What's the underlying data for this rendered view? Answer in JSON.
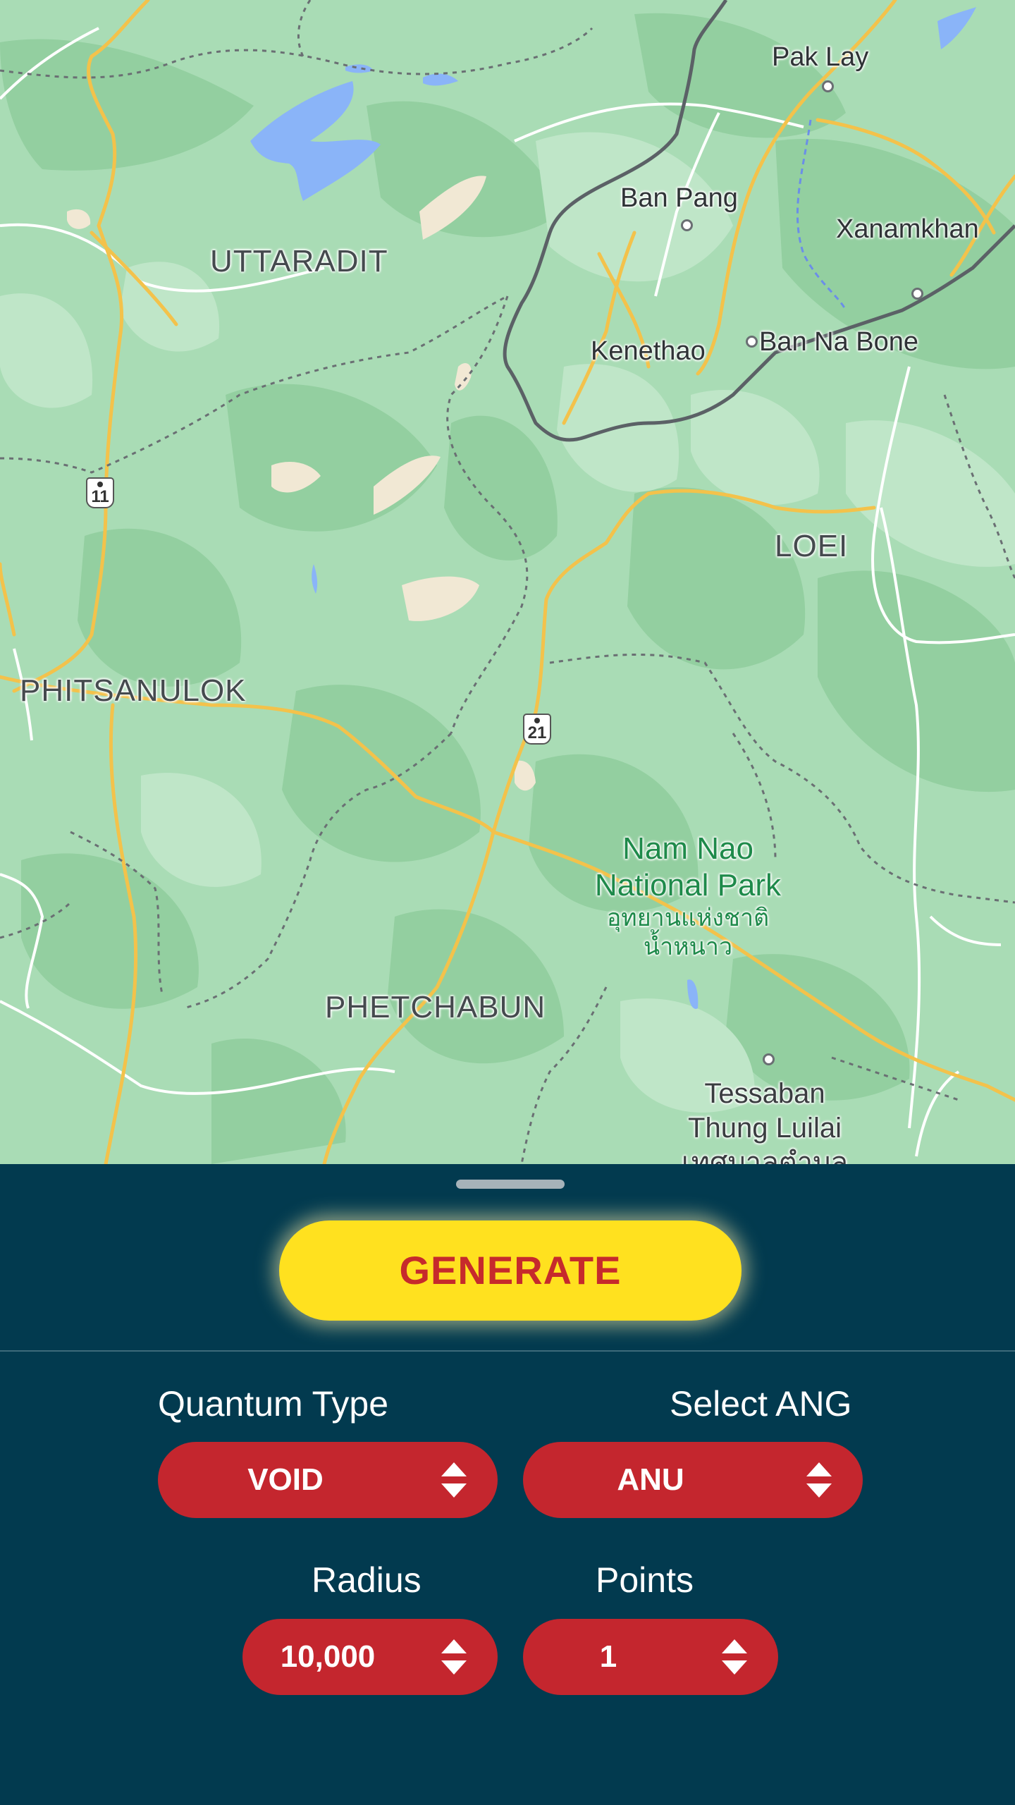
{
  "map": {
    "labels": {
      "pak_lay": "Pak Lay",
      "ban_pang": "Ban Pang",
      "xanamkhan": "Xanamkhan",
      "uttaradit": "UTTARADIT",
      "kenethao": "Kenethao",
      "ban_na_bone": "Ban Na Bone",
      "loei": "LOEI",
      "phitsanulok": "PHITSANULOK",
      "phetchabun": "PHETCHABUN",
      "park_name_line1": "Nam Nao",
      "park_name_line2": "National Park",
      "park_thai_line1": "อุทยานแห่งชาติ",
      "park_thai_line2": "น้ำหนาว",
      "tessaban_line1": "Tessaban",
      "tessaban_line2": "Thung Luilai",
      "tessaban_line3": "เทศบาลตำบล"
    },
    "highway_11": "11",
    "highway_21": "21",
    "colors": {
      "land": "#a9dcb5",
      "forest_dark": "#93cfa0",
      "forest_light": "#bfe6c8",
      "water": "#8ab4f8",
      "highway": "#f3c24b",
      "road": "#ffffff",
      "border": "#5b6166"
    }
  },
  "panel": {
    "generate_label": "GENERATE",
    "quantum_type": {
      "label": "Quantum Type",
      "value": "VOID"
    },
    "select_ang": {
      "label": "Select ANG",
      "value": "ANU"
    },
    "radius": {
      "label": "Radius",
      "value": "10,000"
    },
    "points": {
      "label": "Points",
      "value": "1"
    },
    "colors": {
      "background": "#023a4f",
      "button_yellow": "#ffe11f",
      "button_text": "#c62a2c",
      "select_red": "#c4262e",
      "label_text": "#ffffff"
    }
  }
}
